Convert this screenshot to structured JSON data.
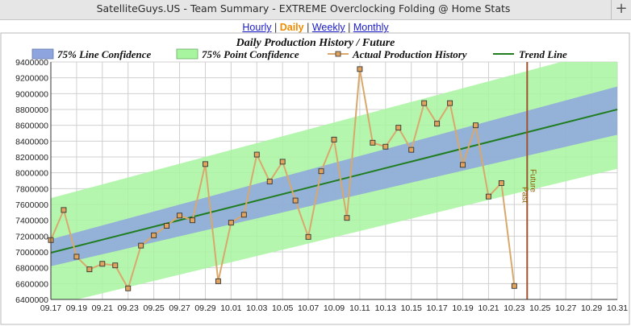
{
  "window": {
    "title": "SatelliteGuys.US - Team Summary - EXTREME Overclocking Folding @ Home Stats",
    "new_tab_icon": "plus-icon"
  },
  "nav": {
    "links": [
      {
        "label": "Hourly",
        "active": false
      },
      {
        "label": "Daily",
        "active": true
      },
      {
        "label": "Weekly",
        "active": false
      },
      {
        "label": "Monthly",
        "active": false
      }
    ],
    "separator": "|"
  },
  "chart_data": {
    "type": "line",
    "title": "Daily Production History / Future",
    "legend": {
      "placement": "top",
      "entries": [
        "75% Line Confidence",
        "75% Point Confidence",
        "Actual Production History",
        "Trend Line"
      ]
    },
    "colors": {
      "line_confidence": "#8ea4de",
      "point_confidence": "#a8f5a0",
      "actual": "#d9a86c",
      "actual_marker_fill": "#e0a45f",
      "trend": "#1f7d1f",
      "divider": "#a0522d",
      "grid": "#d0d0d0"
    },
    "grid": true,
    "x_ticks": [
      "09.17",
      "09.19",
      "09.21",
      "09.23",
      "09.25",
      "09.27",
      "09.29",
      "10.01",
      "10.03",
      "10.05",
      "10.07",
      "10.09",
      "10.11",
      "10.13",
      "10.15",
      "10.17",
      "10.19",
      "10.21",
      "10.23",
      "10.25",
      "10.27",
      "10.29",
      "10.31"
    ],
    "x_range_days": [
      0,
      44
    ],
    "ylim": [
      6400000,
      9400000
    ],
    "y_ticks": [
      "6400000",
      "6600000",
      "6800000",
      "7000000",
      "7200000",
      "7400000",
      "7600000",
      "7800000",
      "8000000",
      "8200000",
      "8400000",
      "8600000",
      "8800000",
      "9000000",
      "9200000",
      "9400000"
    ],
    "series": [
      {
        "name": "Actual Production History",
        "x": [
          "09.17",
          "09.18",
          "09.19",
          "09.20",
          "09.21",
          "09.22",
          "09.23",
          "09.24",
          "09.25",
          "09.26",
          "09.27",
          "09.28",
          "09.29",
          "09.30",
          "10.01",
          "10.02",
          "10.03",
          "10.04",
          "10.05",
          "10.06",
          "10.07",
          "10.08",
          "10.09",
          "10.10",
          "10.11",
          "10.12",
          "10.13",
          "10.14",
          "10.15",
          "10.16",
          "10.17",
          "10.18",
          "10.19",
          "10.20",
          "10.21",
          "10.22",
          "10.23"
        ],
        "values": [
          7150000,
          7530000,
          6940000,
          6780000,
          6850000,
          6830000,
          6540000,
          7080000,
          7210000,
          7330000,
          7460000,
          7400000,
          8110000,
          6630000,
          7370000,
          7470000,
          8230000,
          7890000,
          8140000,
          7650000,
          7190000,
          8020000,
          8420000,
          7430000,
          9310000,
          8380000,
          8330000,
          8570000,
          8290000,
          8880000,
          8620000,
          8880000,
          8100000,
          8600000,
          7700000,
          7870000,
          6570000
        ]
      },
      {
        "name": "Trend Line",
        "x": [
          "09.17",
          "10.31"
        ],
        "values": [
          6990000,
          8800000
        ]
      }
    ],
    "line_confidence_band": {
      "x": [
        "09.17",
        "10.31"
      ],
      "lower": [
        6820000,
        8480000
      ],
      "upper": [
        7160000,
        9090000
      ]
    },
    "point_confidence_band": {
      "x": [
        "09.17",
        "10.31"
      ],
      "lower": [
        6320000,
        8050000
      ],
      "upper": [
        7680000,
        9590000
      ]
    },
    "divider": {
      "x": "10.24",
      "labels": [
        "Past",
        "Future"
      ]
    }
  }
}
